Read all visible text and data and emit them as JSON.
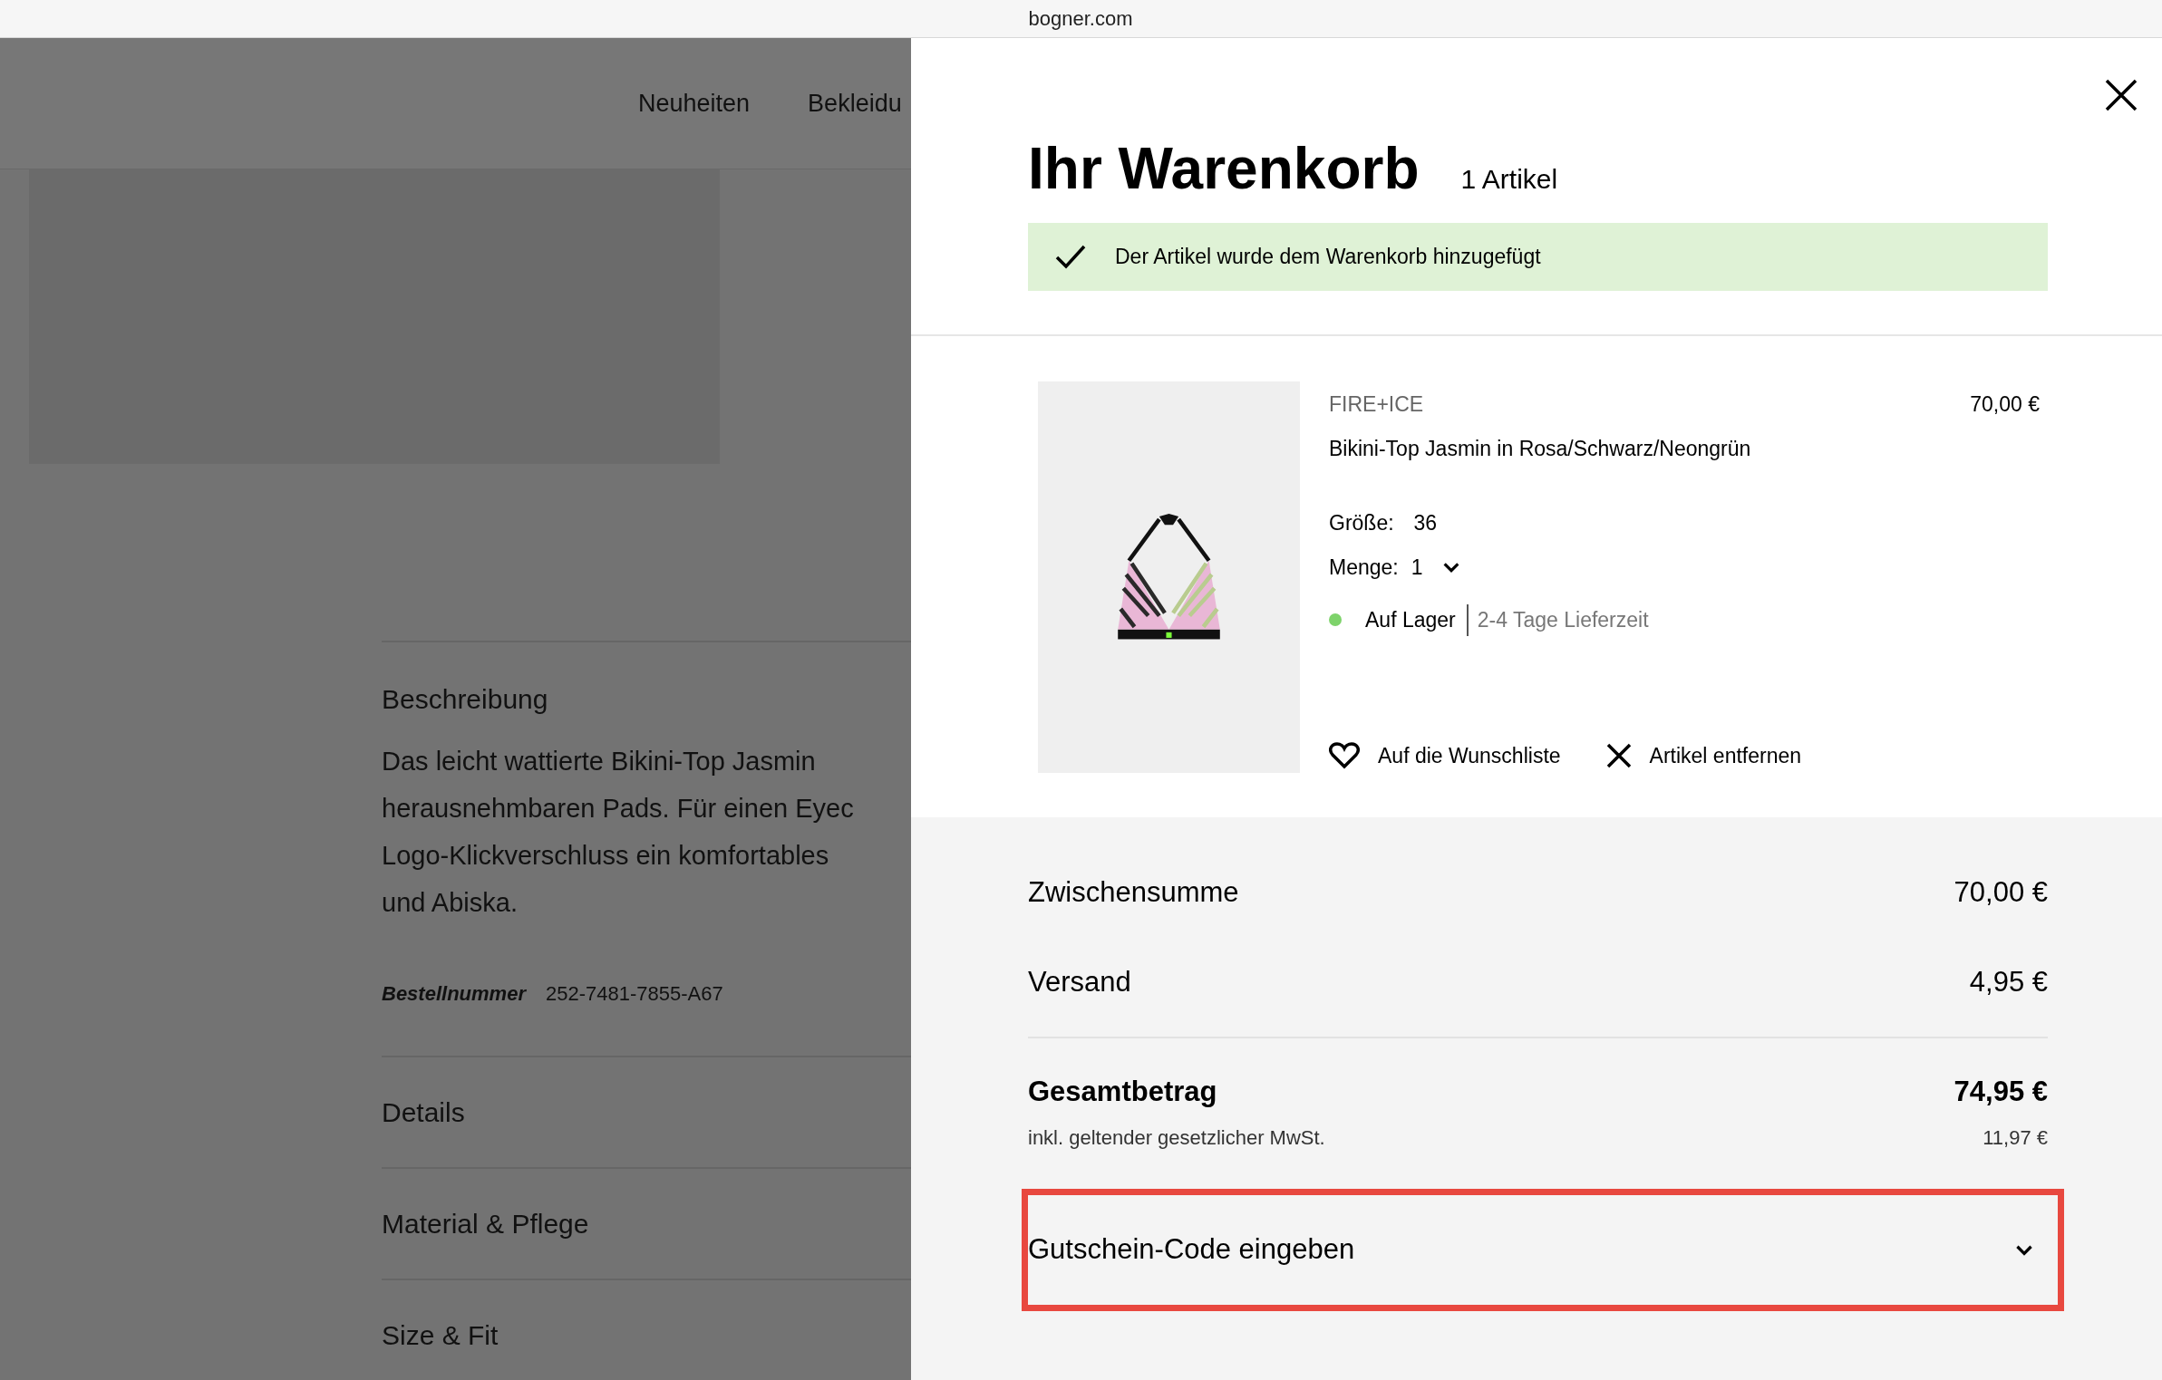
{
  "browser": {
    "url": "bogner.com"
  },
  "page": {
    "nav": [
      "Neuheiten",
      "Bekleidu"
    ],
    "sections": [
      {
        "title": "Beschreibung",
        "expanded": true,
        "lines": [
          "Das leicht wattierte Bikini-Top Jasmin",
          "herausnehmbaren Pads. Für einen Eyec",
          "Logo-Klickverschluss ein komfortables",
          "und Abiska."
        ],
        "order_label": "Bestellnummer",
        "order_number": "252-7481-7855-A67"
      },
      {
        "title": "Details",
        "expanded": false
      },
      {
        "title": "Material & Pflege",
        "expanded": false
      },
      {
        "title": "Size & Fit",
        "expanded": false
      }
    ]
  },
  "cart": {
    "title": "Ihr Warenkorb",
    "count": "1 Artikel",
    "notice": "Der Artikel wurde dem Warenkorb hinzugefügt",
    "item": {
      "brand": "FIRE+ICE",
      "name": "Bikini-Top Jasmin in Rosa/Schwarz/Neongrün",
      "price": "70,00 €",
      "size_label": "Größe:",
      "size": "36",
      "quantity_label": "Menge:",
      "quantity": "1",
      "in_stock": true,
      "stock": "Auf Lager",
      "delivery": "2-4 Tage Lieferzeit",
      "wishlist": "Auf die Wunschliste",
      "remove": "Artikel entfernen"
    },
    "summary": [
      {
        "label": "Zwischensumme",
        "value": "70,00 €"
      },
      {
        "label": "Versand",
        "value": "4,95 €"
      }
    ],
    "total": {
      "label": "Gesamtbetrag",
      "value": "74,95 €",
      "tax_label": "inkl. geltender gesetzlicher MwSt.",
      "tax_value": "11,97 €"
    },
    "voucher": {
      "label": "Gutschein-Code eingeben",
      "expanded": false,
      "highlighted": true
    }
  }
}
